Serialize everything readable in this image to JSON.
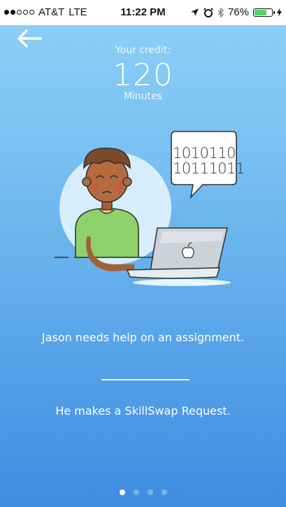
{
  "status_bar": {
    "carrier": "AT&T",
    "network": "LTE",
    "time": "11:22 PM",
    "battery": "76%",
    "battery_level": 0.76,
    "battery_color": "#4cd964"
  },
  "nav": {
    "back_icon": "back-arrow-icon"
  },
  "credit": {
    "label": "Your credit:",
    "value": "120",
    "unit": "Minutes"
  },
  "illustration": {
    "bubble_lines": [
      "1010110",
      "10111011"
    ]
  },
  "captions": [
    {
      "text": "Jason needs help on an assignment."
    },
    {
      "text": "He makes a SkillSwap Request."
    }
  ],
  "pager": {
    "count": 4,
    "active_index": 0
  },
  "colors": {
    "background_top": "#8fd0f7",
    "background_bottom": "#3f8ce3",
    "text": "#ffffff"
  }
}
